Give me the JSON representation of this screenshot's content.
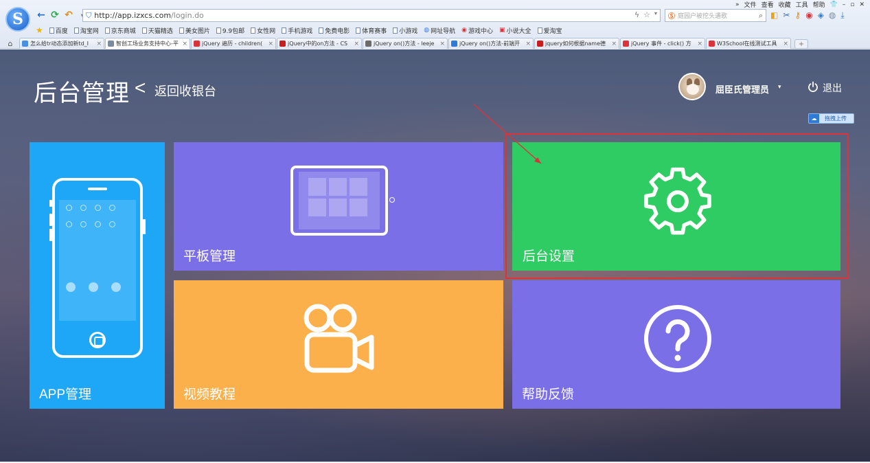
{
  "browser": {
    "menu": [
      "»",
      "文件",
      "查看",
      "收藏",
      "工具",
      "帮助"
    ],
    "logo_letter": "S",
    "url_host": "http://app.izxcs.com",
    "url_path": "/login.do",
    "search_placeholder": "庭园户被挖头遇歌",
    "bookmarks": [
      "百度",
      "淘宝网",
      "京东商城",
      "天猫精选",
      "美女图片",
      "9.9包邮",
      "女性网",
      "手机游戏",
      "免费电影",
      "体育赛事",
      "小游戏",
      "网址导航",
      "游戏中心",
      "小说大全",
      "爱淘宝"
    ],
    "tabs": [
      {
        "label": "怎么给tr动态添加新td_I",
        "color": "#4a90e2"
      },
      {
        "label": "智创工场业务支持中心-平",
        "color": "#7a8aa0"
      },
      {
        "label": "jQuery 遍历 - children(",
        "color": "#d9343b"
      },
      {
        "label": "jQuery中的on方法 - CS",
        "color": "#c81e1e"
      },
      {
        "label": "jQuery on()方法 - leeje",
        "color": "#6b6b6b"
      },
      {
        "label": "jQuery on()方法-前端开",
        "color": "#2f7ad6"
      },
      {
        "label": "jquery如何根据name德",
        "color": "#c81e1e"
      },
      {
        "label": "jQuery 事件 - click() 方",
        "color": "#d9343b"
      },
      {
        "label": "W3School在线测试工具",
        "color": "#d9343b"
      }
    ],
    "active_tab_index": 1
  },
  "header": {
    "title": "后台管理",
    "back_chevron": "<",
    "back_link": "返回收银台",
    "user_name": "屈臣氏管理员",
    "user_caret": "▾",
    "logout": "退出",
    "upload_badge": "拖拽上传"
  },
  "tiles": {
    "app": {
      "label": "APP管理",
      "color": "#1ea7f7",
      "icon": "phone-icon"
    },
    "tablet": {
      "label": "平板管理",
      "color": "#7b6fe8",
      "icon": "tablet-icon"
    },
    "settings": {
      "label": "后台设置",
      "color": "#2fcc64",
      "icon": "gear-icon"
    },
    "video": {
      "label": "视频教程",
      "color": "#fbb04b",
      "icon": "video-camera-icon"
    },
    "help": {
      "label": "帮助反馈",
      "color": "#7b6fe8",
      "icon": "question-circle-icon"
    }
  },
  "annotation": {
    "highlight_color": "#d9343b"
  }
}
